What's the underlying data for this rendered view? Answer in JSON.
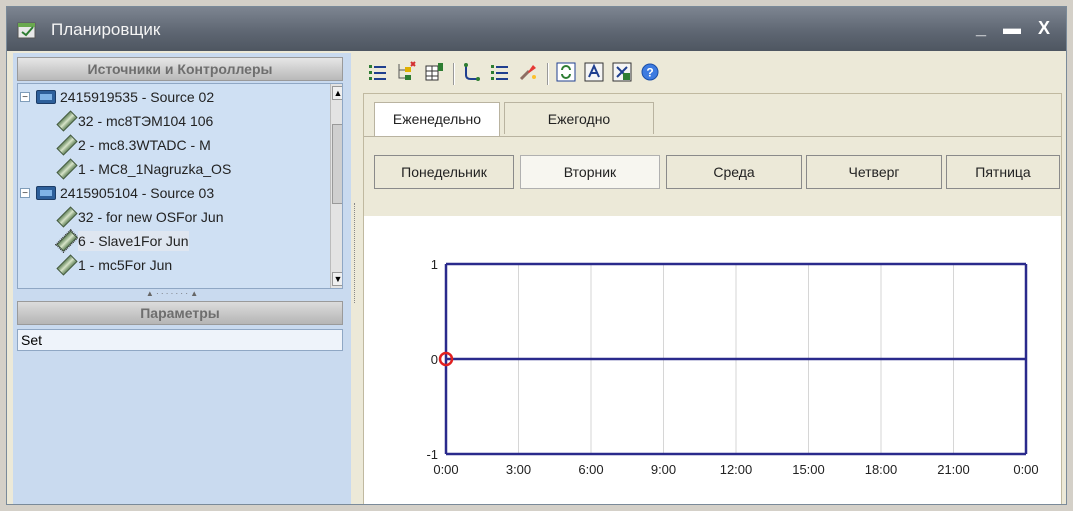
{
  "window": {
    "title": "Планировщик",
    "min_label": "_",
    "max_label": "▬",
    "close_label": "X"
  },
  "sources_panel": {
    "header": "Источники и Контроллеры",
    "tree": [
      {
        "label": "2415919535 - Source 02",
        "type": "source",
        "expanded": true
      },
      {
        "label": "32 - mc8ТЭМ104 106",
        "type": "device"
      },
      {
        "label": "2 - mc8.3WTADC - M",
        "type": "device"
      },
      {
        "label": "1 - MC8_1Nagruzka_OS",
        "type": "device"
      },
      {
        "label": "2415905104 - Source 03",
        "type": "source",
        "expanded": true
      },
      {
        "label": "32 - for new OSFor Jun",
        "type": "device"
      },
      {
        "label": "6 - Slave1For Jun",
        "type": "device",
        "selected": true
      },
      {
        "label": "1 - mc5For Jun",
        "type": "device"
      }
    ]
  },
  "params_panel": {
    "header": "Параметры",
    "value": "Set"
  },
  "tabs": [
    {
      "label": "Еженедельно",
      "active": true
    },
    {
      "label": "Ежегодно",
      "active": false
    }
  ],
  "days": [
    {
      "label": "Понедельник",
      "active": false
    },
    {
      "label": "Вторник",
      "active": true
    },
    {
      "label": "Среда",
      "active": false
    },
    {
      "label": "Четверг",
      "active": false
    },
    {
      "label": "Пятница",
      "active": false
    }
  ],
  "icons": [
    "list-icon",
    "tree-add-icon",
    "table-icon",
    "branch-icon",
    "list-check-icon",
    "brush-icon",
    "refresh-icon",
    "export-icon",
    "import-icon",
    "help-icon"
  ],
  "colors": {
    "line": "#2a2a8c",
    "marker": "#e02020",
    "grid": "#d6d6d6"
  },
  "chart_data": {
    "type": "line",
    "title": "",
    "xlabel": "",
    "ylabel": "",
    "x_ticks": [
      "0:00",
      "3:00",
      "6:00",
      "9:00",
      "12:00",
      "15:00",
      "18:00",
      "21:00",
      "0:00"
    ],
    "y_ticks": [
      "1",
      "0",
      "-1"
    ],
    "ylim": [
      -1,
      1
    ],
    "xlim_hours": [
      0,
      24
    ],
    "grid": "vertical",
    "series": [
      {
        "x": [
          0,
          24
        ],
        "y": [
          0,
          0
        ]
      }
    ],
    "markers": [
      {
        "x": 0,
        "y": 0
      }
    ],
    "box_top": 1,
    "box_bottom": -1
  }
}
